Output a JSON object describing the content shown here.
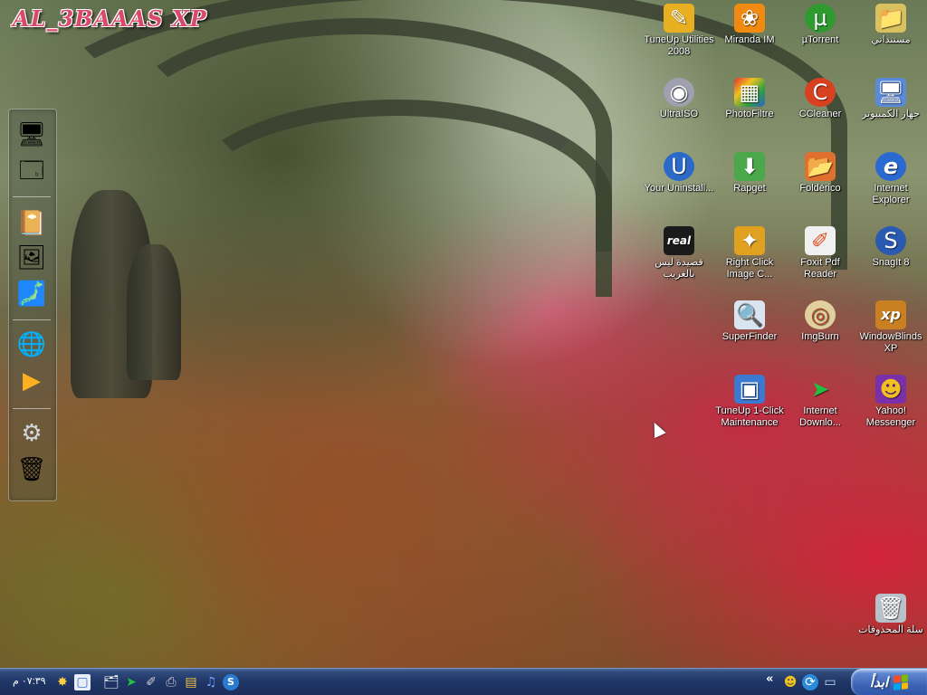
{
  "brand": {
    "title": "AL_3BAAAS XP"
  },
  "dock": {
    "items": [
      {
        "name": "my-computer-icon",
        "glyph": "🖥"
      },
      {
        "name": "show-desktop-icon",
        "glyph": "🗔"
      },
      {
        "name": "folder-icon",
        "glyph": "📔"
      },
      {
        "name": "image-viewer-icon",
        "glyph": "🖼"
      },
      {
        "name": "photo-icon",
        "glyph": "🗾"
      },
      {
        "name": "internet-globe-icon",
        "glyph": "🌐"
      },
      {
        "name": "media-player-icon",
        "glyph": "▶"
      },
      {
        "name": "settings-gear-icon",
        "glyph": "⚙"
      },
      {
        "name": "recycle-bin-icon",
        "glyph": "🗑"
      }
    ]
  },
  "desktop": {
    "icons": [
      {
        "label": "TuneUp Utilities 2008",
        "glyph": "✎",
        "color": "#e8b020"
      },
      {
        "label": "Miranda IM",
        "glyph": "❀",
        "color": "#f08a10"
      },
      {
        "label": "µTorrent",
        "glyph": "µ",
        "color": "#2f9a2f"
      },
      {
        "label": "مستنداتي",
        "glyph": "📁",
        "color": "#d9c060"
      },
      {
        "label": "UltraISO",
        "glyph": "◉",
        "color": "#a0a0b0"
      },
      {
        "label": "PhotoFiltre",
        "glyph": "▦",
        "color": "#3a6ad0"
      },
      {
        "label": "CCleaner",
        "glyph": "C",
        "color": "#d84020"
      },
      {
        "label": "جهاز الكمبيوتر",
        "glyph": "🖥",
        "color": "#5a8ad8"
      },
      {
        "label": "Your Uninstall...",
        "glyph": "U",
        "color": "#2c6ac8"
      },
      {
        "label": "Rapget",
        "glyph": "⬇",
        "color": "#4aa84a"
      },
      {
        "label": "Foldérico",
        "glyph": "📂",
        "color": "#e07030"
      },
      {
        "label": "Internet Explorer",
        "glyph": "e",
        "color": "#2a6ad0"
      },
      {
        "label": "قصيدة ليس بالغريب",
        "glyph": "real",
        "color": "#1a1a1a"
      },
      {
        "label": "Right Click Image C...",
        "glyph": "✦",
        "color": "#e0a020"
      },
      {
        "label": "Foxit Pdf Reader",
        "glyph": "✐",
        "color": "#f0f0f0"
      },
      {
        "label": "SnagIt 8",
        "glyph": "S",
        "color": "#2a5ab0"
      },
      {
        "label": "SuperFinder",
        "glyph": "🔍",
        "color": "#d8e4f0"
      },
      {
        "label": "ImgBurn",
        "glyph": "◎",
        "color": "#e0d0a0"
      },
      {
        "label": "WindowBlinds XP",
        "glyph": "xp",
        "color": "#c88020"
      },
      {
        "label": "TuneUp 1-Click Maintenance",
        "glyph": "▣",
        "color": "#3a7ad0"
      },
      {
        "label": "Internet Downlo...",
        "glyph": "➤",
        "color": "#20c040"
      },
      {
        "label": "Yahoo! Messenger",
        "glyph": "☻",
        "color": "#7a30a8"
      },
      {
        "label": "سلة المحذوفات",
        "glyph": "🗑",
        "color": "#b8c0c8"
      }
    ]
  },
  "taskbar": {
    "start_label": "ابدأ",
    "clock": "٠٧:٣٩ م",
    "tray_icons": [
      {
        "name": "tray-yahoo-icon",
        "glyph": "☻"
      },
      {
        "name": "tray-sync-icon",
        "glyph": "⟳"
      },
      {
        "name": "tray-network-icon",
        "glyph": "▭"
      }
    ],
    "quick_launch": [
      {
        "name": "ql-notify-icon",
        "glyph": "✸"
      },
      {
        "name": "ql-window-icon",
        "glyph": "▢"
      },
      {
        "name": "ql-explorer-icon",
        "glyph": "🗂"
      },
      {
        "name": "ql-download-icon",
        "glyph": "➤"
      },
      {
        "name": "ql-tool-icon",
        "glyph": "✐"
      },
      {
        "name": "ql-printer-icon",
        "glyph": "⎙"
      },
      {
        "name": "ql-disk-icon",
        "glyph": "▤"
      },
      {
        "name": "ql-media-icon",
        "glyph": "♫"
      },
      {
        "name": "ql-snagit-icon",
        "glyph": "S"
      }
    ],
    "chevron": "«"
  },
  "colors": {
    "taskbar": "#1f3566",
    "start": "#3c64b4",
    "brand": "#d94a6a"
  }
}
